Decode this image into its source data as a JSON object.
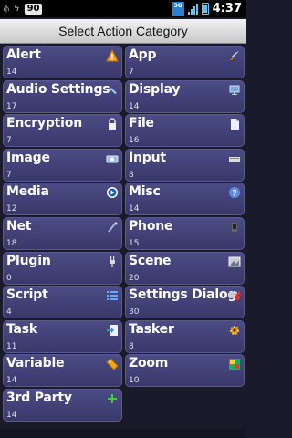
{
  "status": {
    "battery_badge": "90",
    "network": "3G",
    "time": "4:37"
  },
  "dialog": {
    "title": "Select Action Category"
  },
  "categories": [
    {
      "label": "Alert",
      "count": "14",
      "icon": "warning-icon"
    },
    {
      "label": "App",
      "count": "7",
      "icon": "rocket-icon"
    },
    {
      "label": "Audio Settings",
      "count": "17",
      "icon": "audio-settings-icon"
    },
    {
      "label": "Display",
      "count": "14",
      "icon": "monitor-icon"
    },
    {
      "label": "Encryption",
      "count": "7",
      "icon": "lock-icon"
    },
    {
      "label": "File",
      "count": "16",
      "icon": "file-icon"
    },
    {
      "label": "Image",
      "count": "7",
      "icon": "image-icon"
    },
    {
      "label": "Input",
      "count": "8",
      "icon": "keyboard-icon"
    },
    {
      "label": "Media",
      "count": "12",
      "icon": "media-play-icon"
    },
    {
      "label": "Misc",
      "count": "14",
      "icon": "help-icon"
    },
    {
      "label": "Net",
      "count": "18",
      "icon": "globe-icon"
    },
    {
      "label": "Phone",
      "count": "15",
      "icon": "phone-icon"
    },
    {
      "label": "Plugin",
      "count": "0",
      "icon": "plug-icon"
    },
    {
      "label": "Scene",
      "count": "20",
      "icon": "scene-icon"
    },
    {
      "label": "Script",
      "count": "4",
      "icon": "list-icon"
    },
    {
      "label": "Settings Dialog",
      "count": "30",
      "icon": "settings-dialog-icon"
    },
    {
      "label": "Task",
      "count": "11",
      "icon": "task-icon"
    },
    {
      "label": "Tasker",
      "count": "8",
      "icon": "tasker-gear-icon"
    },
    {
      "label": "Variable",
      "count": "14",
      "icon": "tag-icon"
    },
    {
      "label": "Zoom",
      "count": "10",
      "icon": "zoom-widget-icon"
    },
    {
      "label": "3rd Party",
      "count": "14",
      "icon": "plus-icon"
    }
  ]
}
